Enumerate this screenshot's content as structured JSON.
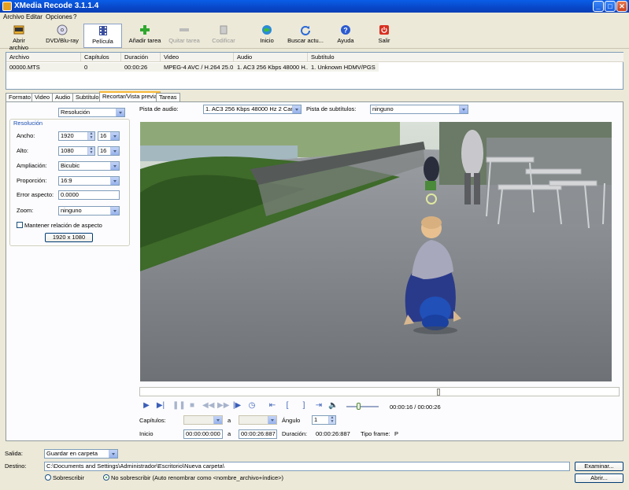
{
  "window": {
    "title": "XMedia Recode 3.1.1.4"
  },
  "menu": [
    "Archivo",
    "Editar",
    "Opciones",
    "?"
  ],
  "toolbar": {
    "open_file": "Abrir archivo",
    "dvd_bluray": "DVD/Blu-ray",
    "movie": "Película",
    "add_task": "Añadir tarea",
    "remove_task": "Quitar tarea",
    "encode": "Codificar",
    "home": "Inicio",
    "check_updates": "Buscar actu...",
    "help": "Ayuda",
    "exit": "Salir"
  },
  "file_table": {
    "headers": [
      "Archivo",
      "Capítulos",
      "Duración",
      "Video",
      "Audio",
      "Subtítulo"
    ],
    "rows": [
      [
        "00000.MTS",
        "0",
        "00:00:26",
        "MPEG-4 AVC / H.264 25.0...",
        "1. AC3 256 Kbps 48000 H...",
        "1. Unknown HDMV/PGS"
      ]
    ]
  },
  "tabs": [
    "Formato",
    "Video",
    "Audio",
    "Subtítulo",
    "Recortar/Vista previa",
    "Tareas"
  ],
  "active_tab": "Recortar/Vista previa",
  "left_panel": {
    "mode": "Resolución",
    "group_title": "Resolución",
    "width_label": "Ancho:",
    "width_value": "1920",
    "width_mod": "16",
    "height_label": "Alto:",
    "height_value": "1080",
    "height_mod": "16",
    "scaling_label": "Ampliación:",
    "scaling_value": "Bicubic",
    "aspect_label": "Proporción:",
    "aspect_value": "16:9",
    "aspect_error_label": "Error aspecto:",
    "aspect_error_value": "0.0000",
    "zoom_label": "Zoom:",
    "zoom_value": "ninguno",
    "keep_aspect_label": "Mantener relación de aspecto",
    "resolution_button": "1920 x 1080"
  },
  "audio_track": {
    "label": "Pista de audio:",
    "value": "1. AC3 256 Kbps 48000 Hz 2 Canales"
  },
  "subtitle_track": {
    "label": "Pista de subtítulos:",
    "value": "ninguno"
  },
  "player": {
    "timeline_position": 0.627,
    "volume_level": 0.35,
    "time_display": "00:00:16 / 00:00:26"
  },
  "chapters": {
    "label": "Capítulos:",
    "to": "a",
    "angle_label": "Ángulo",
    "angle_value": "1"
  },
  "range": {
    "start_label": "Inicio",
    "start_value": "00:00:00:000",
    "to": "a",
    "end_value": "00:00:26:887",
    "duration_label": "Duración:",
    "duration_value": "00:00:26:887",
    "frame_type_label": "Tipo frame:",
    "frame_type_value": "P"
  },
  "output": {
    "label": "Salida:",
    "value": "Guardar en carpeta",
    "dest_label": "Destino:",
    "dest_value": "C:\\Documents and Settings\\Administrador\\Escritorio\\Nueva carpeta\\",
    "browse_button": "Examinar...",
    "open_button": "Abrir...",
    "overwrite_label": "Sobrescribir",
    "no_overwrite_label": "No sobrescribir (Auto renombrar como <nombre_archivo+índice>)"
  },
  "colors": {
    "titlebar": "#0a5ee8",
    "tab_highlight": "#f8b838",
    "face": "#ece9d8"
  }
}
